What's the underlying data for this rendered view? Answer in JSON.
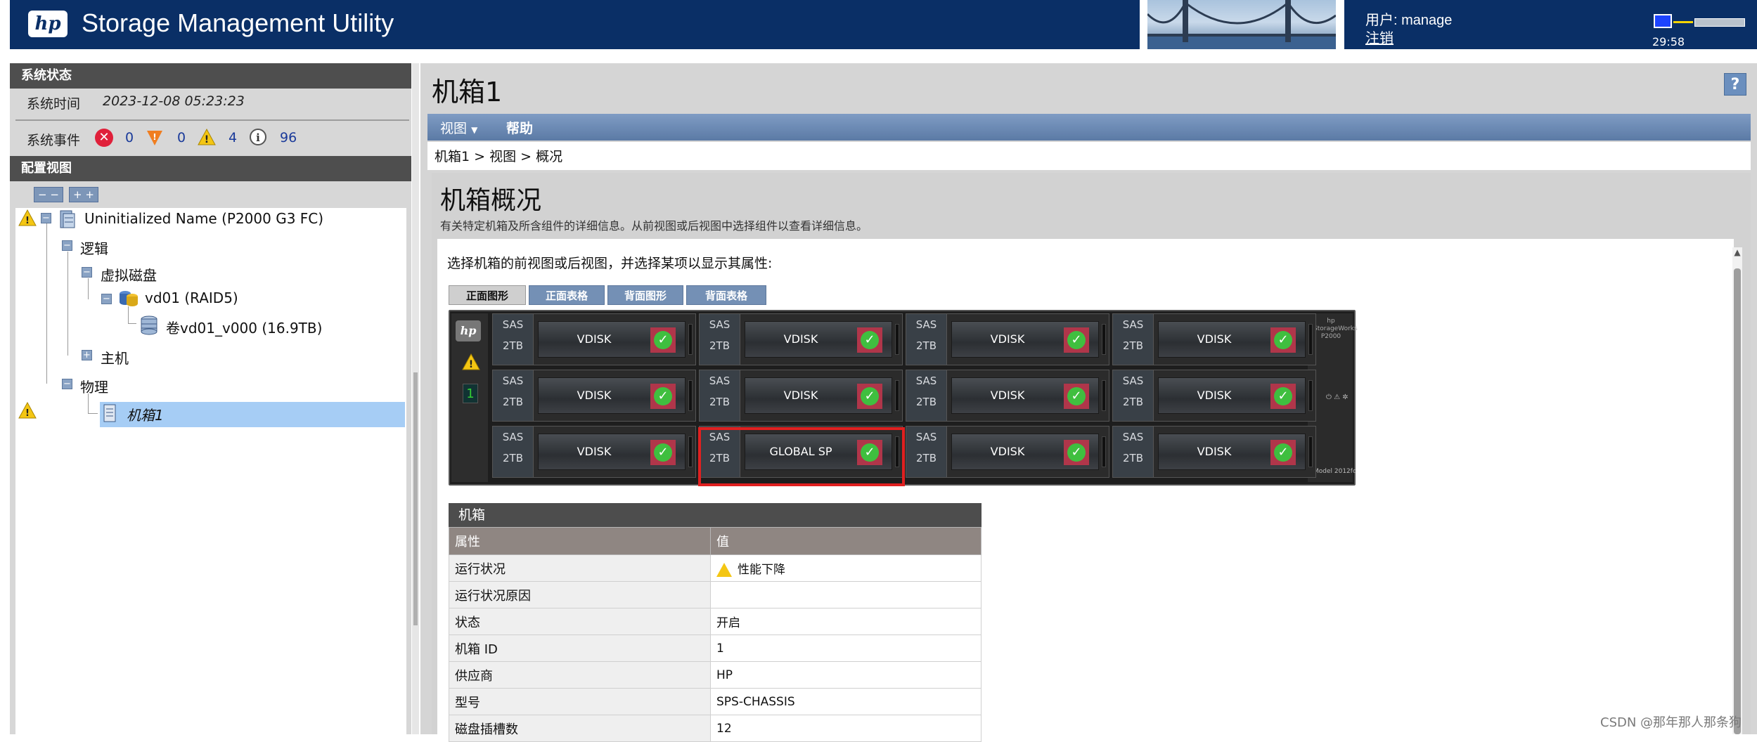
{
  "app": {
    "title": "Storage Management Utility",
    "logo_text": "hp"
  },
  "user": {
    "label": "用户: manage",
    "logout": "注销",
    "session_time": "29:58"
  },
  "system_status": {
    "header": "系统状态",
    "time_label": "系统时间",
    "time_value": "2023-12-08 05:23:23",
    "events_label": "系统事件",
    "events": [
      {
        "type": "critical",
        "icon": "error-icon",
        "color": "#e0203a",
        "count": "0"
      },
      {
        "type": "error",
        "icon": "error-triangle-icon",
        "color": "#f07e20",
        "count": "0"
      },
      {
        "type": "warning",
        "icon": "warning-icon",
        "color": "#f4c613",
        "count": "4"
      },
      {
        "type": "info",
        "icon": "info-icon",
        "color": "#ffffff",
        "count": "96"
      }
    ]
  },
  "config_view": {
    "header": "配置视图",
    "collapse_label": "− −",
    "expand_label": "+ +",
    "tree": {
      "root": "Uninitialized Name (P2000 G3 FC)",
      "logical": "逻辑",
      "vdisks": "虚拟磁盘",
      "vdisk": "vd01 (RAID5)",
      "volume": "卷vd01_v000 (16.9TB)",
      "host": "主机",
      "physical": "物理",
      "enclosure": "机箱1"
    }
  },
  "page": {
    "title": "机箱1",
    "help": "?",
    "menu": {
      "view": "视图",
      "help": "帮助"
    },
    "breadcrumb": "机箱1 > 视图 > 概况",
    "overview_title": "机箱概况",
    "overview_desc": "有关特定机箱及所含组件的详细信息。从前视图或后视图中选择组件以查看详细信息。",
    "select_hint": "选择机箱的前视图或后视图，并选择某项以显示其属性:",
    "tabs": [
      "正面图形",
      "正面表格",
      "背面图形",
      "背面表格"
    ],
    "active_tab": "正面图形"
  },
  "chassis": {
    "hp_logo": "hp",
    "enclosure_id": "1",
    "right_label": "hp StorageWorks P2000",
    "right_leds": "⏻ ⚠ ✲",
    "model_text": "Model 2012fc",
    "drives": [
      {
        "bus": "SAS",
        "size": "2TB",
        "name": "VDISK",
        "status": "ok"
      },
      {
        "bus": "SAS",
        "size": "2TB",
        "name": "VDISK",
        "status": "ok"
      },
      {
        "bus": "SAS",
        "size": "2TB",
        "name": "VDISK",
        "status": "ok"
      },
      {
        "bus": "SAS",
        "size": "2TB",
        "name": "VDISK",
        "status": "ok"
      },
      {
        "bus": "SAS",
        "size": "2TB",
        "name": "VDISK",
        "status": "ok"
      },
      {
        "bus": "SAS",
        "size": "2TB",
        "name": "VDISK",
        "status": "ok"
      },
      {
        "bus": "SAS",
        "size": "2TB",
        "name": "VDISK",
        "status": "ok"
      },
      {
        "bus": "SAS",
        "size": "2TB",
        "name": "VDISK",
        "status": "ok"
      },
      {
        "bus": "SAS",
        "size": "2TB",
        "name": "VDISK",
        "status": "ok"
      },
      {
        "bus": "SAS",
        "size": "2TB",
        "name": "GLOBAL SP",
        "status": "ok"
      },
      {
        "bus": "SAS",
        "size": "2TB",
        "name": "VDISK",
        "status": "ok"
      },
      {
        "bus": "SAS",
        "size": "2TB",
        "name": "VDISK",
        "status": "ok"
      }
    ]
  },
  "properties": {
    "header": "机箱",
    "col_property": "属性",
    "col_value": "值",
    "rows": [
      {
        "key": "运行状况",
        "value": "性能下降",
        "warn": true
      },
      {
        "key": "运行状况原因",
        "value": ""
      },
      {
        "key": "状态",
        "value": "开启"
      },
      {
        "key": "机箱 ID",
        "value": "1"
      },
      {
        "key": "供应商",
        "value": "HP"
      },
      {
        "key": "型号",
        "value": "SPS-CHASSIS"
      },
      {
        "key": "磁盘插槽数",
        "value": "12"
      }
    ]
  },
  "watermark": "CSDN @那年那人那条狗"
}
